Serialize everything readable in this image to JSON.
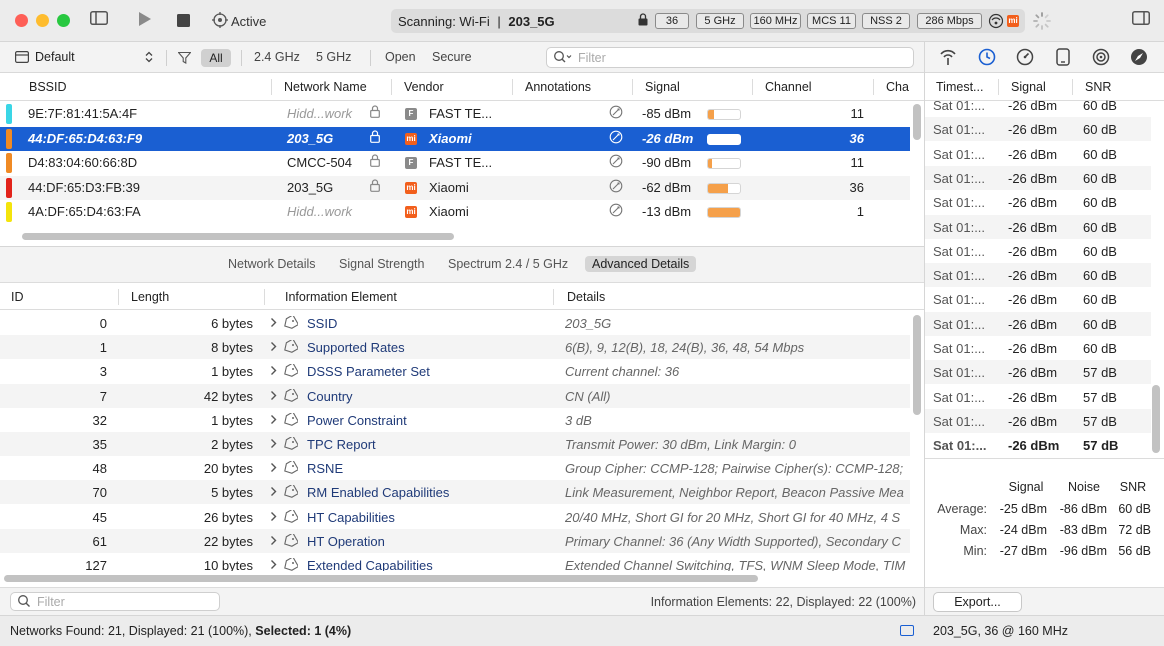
{
  "toolbar": {
    "active_label": "Active",
    "scan_prefix": "Scanning: Wi-Fi",
    "scan_network": "203_5G",
    "chips": [
      "36",
      "5 GHz",
      "160 MHz",
      "MCS 11",
      "NSS 2",
      "286 Mbps"
    ],
    "vendor_badge": "mi"
  },
  "filter_bar": {
    "profile": "Default",
    "all": "All",
    "band_24": "2.4 GHz",
    "band_5": "5 GHz",
    "open": "Open",
    "secure": "Secure",
    "search_placeholder": "Filter"
  },
  "networks": {
    "columns": [
      "BSSID",
      "Network Name",
      "Vendor",
      "Annotations",
      "Signal",
      "Channel",
      "Cha"
    ],
    "rows": [
      {
        "bssid": "9E:7F:81:41:5A:4F",
        "name": "Hidd...work",
        "hidden": true,
        "locked": true,
        "vendor_badge": "F",
        "vendor": "FAST TE...",
        "signal": "-85 dBm",
        "signal_level": 0.2,
        "channel": "11",
        "color": "#3ad6e6"
      },
      {
        "bssid": "44:DF:65:D4:63:F9",
        "name": "203_5G",
        "hidden": false,
        "locked": true,
        "vendor_badge": "mi",
        "vendor": "Xiaomi",
        "signal": "-26 dBm",
        "signal_level": 0.95,
        "channel": "36",
        "color": "#f08a24"
      },
      {
        "bssid": "D4:83:04:60:66:8D",
        "name": "CMCC-504",
        "hidden": false,
        "locked": true,
        "vendor_badge": "F",
        "vendor": "FAST TE...",
        "signal": "-90 dBm",
        "signal_level": 0.12,
        "channel": "11",
        "color": "#f08a24"
      },
      {
        "bssid": "44:DF:65:D3:FB:39",
        "name": "203_5G",
        "hidden": false,
        "locked": true,
        "vendor_badge": "mi",
        "vendor": "Xiaomi",
        "signal": "-62 dBm",
        "signal_level": 0.62,
        "channel": "36",
        "color": "#e2231a"
      },
      {
        "bssid": "4A:DF:65:D4:63:FA",
        "name": "Hidd...work",
        "hidden": true,
        "locked": false,
        "vendor_badge": "mi",
        "vendor": "Xiaomi",
        "signal": "-13 dBm",
        "signal_level": 1.0,
        "channel": "1",
        "color": "#f4e40c"
      }
    ]
  },
  "detail_tabs": [
    "Network Details",
    "Signal Strength",
    "Spectrum 2.4 / 5 GHz",
    "Advanced Details"
  ],
  "info_elements": {
    "columns": [
      "ID",
      "Length",
      "Information Element",
      "Details"
    ],
    "rows": [
      {
        "id": "0",
        "length": "6 bytes",
        "name": "SSID",
        "details": "203_5G"
      },
      {
        "id": "1",
        "length": "8 bytes",
        "name": "Supported Rates",
        "details": "6(B), 9, 12(B), 18, 24(B), 36, 48, 54 Mbps"
      },
      {
        "id": "3",
        "length": "1 bytes",
        "name": "DSSS Parameter Set",
        "details": "Current channel: 36"
      },
      {
        "id": "7",
        "length": "42 bytes",
        "name": "Country",
        "details": "CN (All)"
      },
      {
        "id": "32",
        "length": "1 bytes",
        "name": "Power Constraint",
        "details": "3 dB"
      },
      {
        "id": "35",
        "length": "2 bytes",
        "name": "TPC Report",
        "details": "Transmit Power: 30 dBm, Link Margin: 0"
      },
      {
        "id": "48",
        "length": "20 bytes",
        "name": "RSNE",
        "details": "Group Cipher: CCMP-128; Pairwise Cipher(s): CCMP-128;"
      },
      {
        "id": "70",
        "length": "5 bytes",
        "name": "RM Enabled Capabilities",
        "details": "Link Measurement, Neighbor Report, Beacon Passive Mea"
      },
      {
        "id": "45",
        "length": "26 bytes",
        "name": "HT Capabilities",
        "details": "20/40 MHz, Short GI for 20 MHz, Short GI for 40 MHz, 4 S"
      },
      {
        "id": "61",
        "length": "22 bytes",
        "name": "HT Operation",
        "details": "Primary Channel: 36 (Any Width Supported), Secondary C"
      },
      {
        "id": "127",
        "length": "10 bytes",
        "name": "Extended Capabilities",
        "details": "Extended Channel Switching, TFS, WNM Sleep Mode, TIM"
      }
    ],
    "filter_placeholder": "Filter",
    "count_text": "Information Elements: 22, Displayed: 22 (100%)"
  },
  "status": {
    "left_prefix": "Networks Found: 21, Displayed: 21 (100%),",
    "left_selected": "Selected: 1 (4%)",
    "right": "203_5G, 36 @ 160 MHz"
  },
  "signal_history": {
    "columns": [
      "Timest...",
      "Signal",
      "SNR"
    ],
    "rows": [
      {
        "time": "Sat 01:...",
        "signal": "-26 dBm",
        "snr": "60 dB"
      },
      {
        "time": "Sat 01:...",
        "signal": "-26 dBm",
        "snr": "60 dB"
      },
      {
        "time": "Sat 01:...",
        "signal": "-26 dBm",
        "snr": "60 dB"
      },
      {
        "time": "Sat 01:...",
        "signal": "-26 dBm",
        "snr": "60 dB"
      },
      {
        "time": "Sat 01:...",
        "signal": "-26 dBm",
        "snr": "60 dB"
      },
      {
        "time": "Sat 01:...",
        "signal": "-26 dBm",
        "snr": "60 dB"
      },
      {
        "time": "Sat 01:...",
        "signal": "-26 dBm",
        "snr": "60 dB"
      },
      {
        "time": "Sat 01:...",
        "signal": "-26 dBm",
        "snr": "60 dB"
      },
      {
        "time": "Sat 01:...",
        "signal": "-26 dBm",
        "snr": "60 dB"
      },
      {
        "time": "Sat 01:...",
        "signal": "-26 dBm",
        "snr": "60 dB"
      },
      {
        "time": "Sat 01:...",
        "signal": "-26 dBm",
        "snr": "60 dB"
      },
      {
        "time": "Sat 01:...",
        "signal": "-26 dBm",
        "snr": "57 dB"
      },
      {
        "time": "Sat 01:...",
        "signal": "-26 dBm",
        "snr": "57 dB"
      },
      {
        "time": "Sat 01:...",
        "signal": "-26 dBm",
        "snr": "57 dB"
      },
      {
        "time": "Sat 01:...",
        "signal": "-26 dBm",
        "snr": "57 dB"
      }
    ]
  },
  "stats": {
    "headers": [
      "Signal",
      "Noise",
      "SNR"
    ],
    "rows": [
      {
        "label": "Average:",
        "signal": "-25 dBm",
        "noise": "-86 dBm",
        "snr": "60 dB"
      },
      {
        "label": "Max:",
        "signal": "-24 dBm",
        "noise": "-83 dBm",
        "snr": "72 dB"
      },
      {
        "label": "Min:",
        "signal": "-27 dBm",
        "noise": "-96 dBm",
        "snr": "56 dB"
      }
    ]
  },
  "export_label": "Export...",
  "colors": {
    "accent": "#1a5fd2",
    "signal_fill": "#f5a04a",
    "xiaomi": "#f25f1c",
    "fast": "#8a8a8a"
  }
}
